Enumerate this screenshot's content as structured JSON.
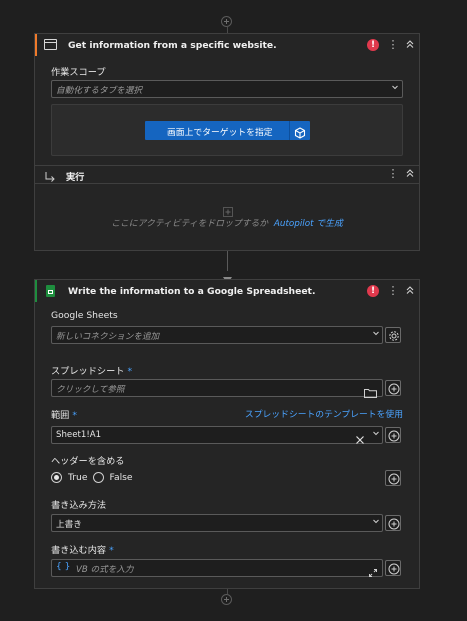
{
  "card1": {
    "title": "Get information from a specific website.",
    "scope_label": "作業スコープ",
    "scope_placeholder": "自動化するタブを選択",
    "target_button": "画面上でターゲットを指定",
    "run_label": "実行",
    "drop_hint": "ここにアクティビティをドロップするか",
    "autopilot_link": "Autopilot で生成"
  },
  "card2": {
    "title": "Write the information to a Google Spreadsheet.",
    "connection_label": "Google Sheets",
    "connection_placeholder": "新しいコネクションを追加",
    "spreadsheet_label": "スプレッドシート",
    "spreadsheet_placeholder": "クリックして参照",
    "range_label": "範囲",
    "template_link": "スプレッドシートのテンプレートを使用",
    "range_value": "Sheet1!A1",
    "header_label": "ヘッダーを含める",
    "radio_true": "True",
    "radio_false": "False",
    "write_method_label": "書き込み方法",
    "write_method_value": "上書き",
    "content_label": "書き込む内容",
    "content_placeholder": "VB の式を入力",
    "vb_icon_text": "{ }"
  },
  "required_mark": "*",
  "colors": {
    "accent_blue": "#4aa3ff",
    "button_blue": "#1565c0",
    "error_red": "#e0394d",
    "card1_stripe": "#f07a2a",
    "card2_stripe": "#1e8e3e"
  }
}
